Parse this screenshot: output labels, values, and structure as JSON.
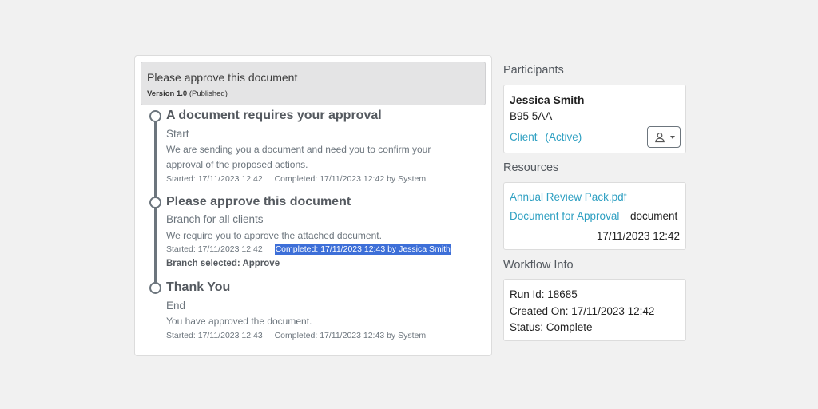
{
  "workflow": {
    "title": "Please approve this document",
    "version_label": "Version 1.0",
    "version_state": "(Published)",
    "steps": [
      {
        "title": "A document requires your approval",
        "subtitle": "Start",
        "description": "We are sending you a document and need you to confirm your approval of the proposed actions.",
        "started": "Started: 17/11/2023 12:42",
        "completed": "Completed: 17/11/2023 12:42 by System"
      },
      {
        "title": "Please approve this document",
        "subtitle": "Branch for all clients",
        "description": "We require you to approve the attached document.",
        "started": "Started: 17/11/2023 12:42",
        "completed": "Completed: 17/11/2023 12:43 by Jessica Smith",
        "branch": "Branch selected: Approve"
      },
      {
        "title": "Thank You",
        "subtitle": "End",
        "description": "You have approved the document.",
        "started": "Started: 17/11/2023 12:43",
        "completed": "Completed: 17/11/2023 12:43 by System"
      }
    ]
  },
  "participants": {
    "heading": "Participants",
    "name": "Jessica Smith",
    "code": "B95 5AA",
    "role": "Client",
    "status": "(Active)",
    "menu_icon": "user-icon"
  },
  "resources": {
    "heading": "Resources",
    "items": [
      {
        "name": "Annual Review Pack.pdf"
      },
      {
        "name": "Document for Approval",
        "type": "document",
        "date": "17/11/2023 12:42"
      }
    ]
  },
  "workflow_info": {
    "heading": "Workflow Info",
    "run_id": "Run Id: 18685",
    "created_on": "Created On: 17/11/2023 12:42",
    "status": "Status: Complete"
  },
  "colors": {
    "link": "#2fa0c2",
    "selection": "#3d6fd8",
    "timeline": "#6c757d"
  }
}
